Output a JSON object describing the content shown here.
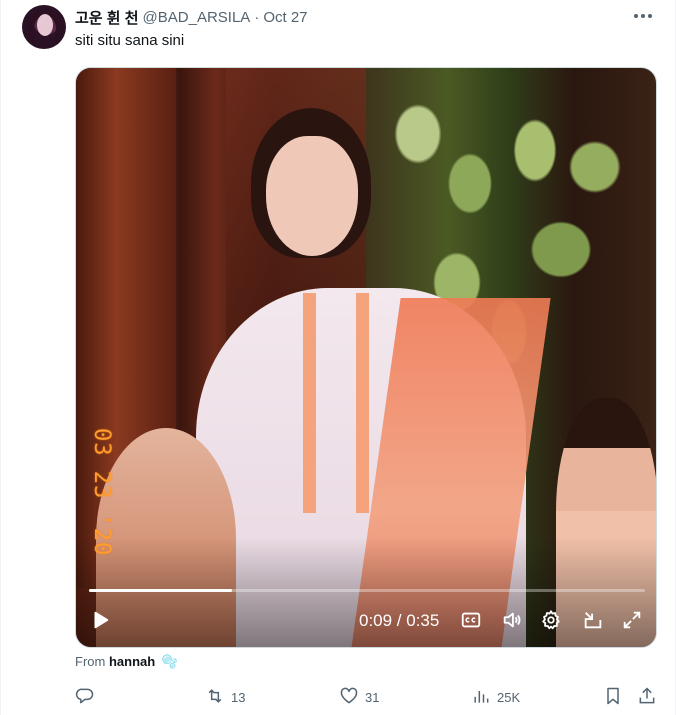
{
  "tweet": {
    "display_name": "고운 휜 천",
    "handle": "@BAD_ARSILA",
    "separator": "·",
    "date": "Oct 27",
    "text": "siti situ sana sini"
  },
  "video": {
    "datestamp": "03 23 '20",
    "current_time": "0:09",
    "duration": "0:35",
    "time_display": "0:09 / 0:35",
    "progress_fraction": 0.257
  },
  "source": {
    "prefix": "From",
    "author": "hannah",
    "emoji": "🫧"
  },
  "actions": {
    "reply_count": "",
    "retweet_count": "13",
    "like_count": "31",
    "views_count": "25K"
  },
  "icons": {
    "more": "more-horizontal-icon",
    "play": "play-icon",
    "captions": "captions-icon",
    "volume": "volume-icon",
    "settings": "gear-icon",
    "pip": "picture-in-picture-icon",
    "fullscreen": "fullscreen-icon",
    "reply": "reply-icon",
    "retweet": "retweet-icon",
    "like": "heart-icon",
    "views": "views-icon",
    "bookmark": "bookmark-icon",
    "share": "share-icon"
  }
}
